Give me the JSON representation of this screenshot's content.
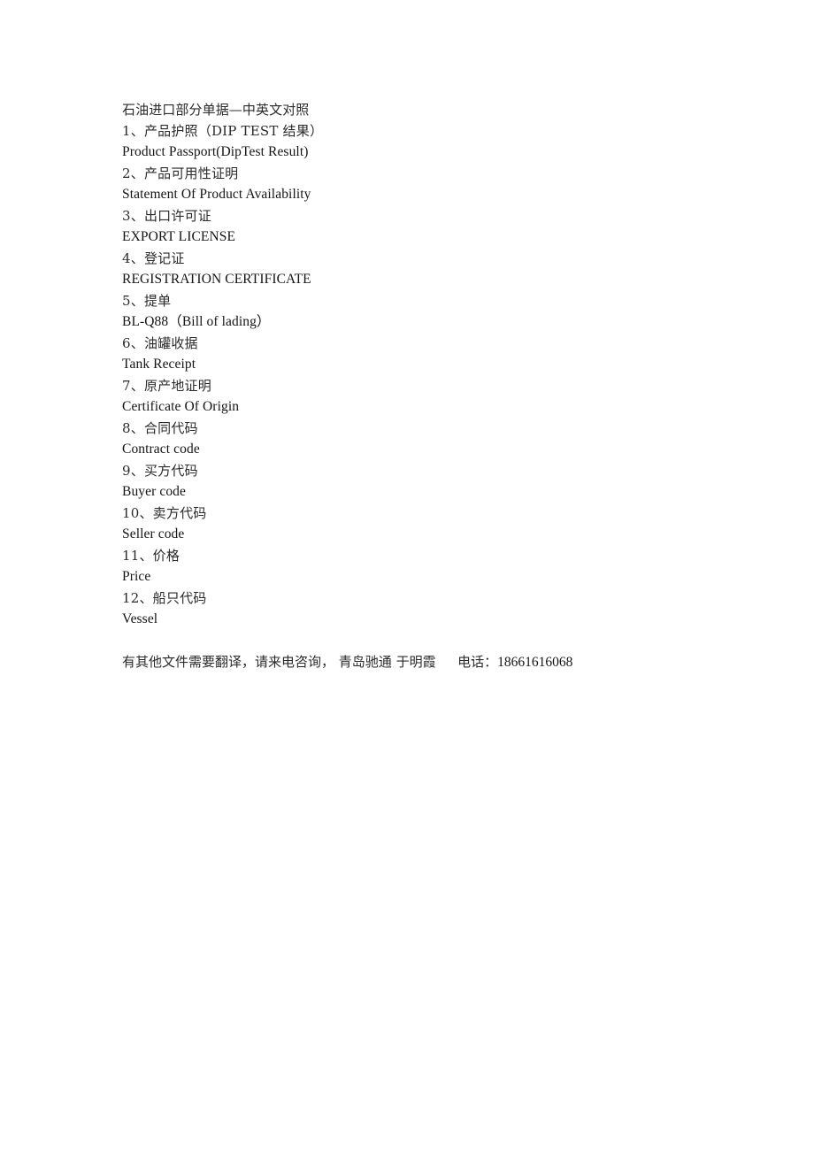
{
  "document": {
    "title": "石油进口部分单据—中英文对照",
    "lines": [
      {
        "lang": "cn",
        "text": "1、产品护照（DIP TEST 结果）"
      },
      {
        "lang": "en",
        "text": "Product Passport(DipTest Result)"
      },
      {
        "lang": "cn",
        "text": "2、产品可用性证明"
      },
      {
        "lang": "en",
        "text": "Statement Of Product Availability"
      },
      {
        "lang": "cn",
        "text": "3、出口许可证"
      },
      {
        "lang": "en",
        "text": "EXPORT LICENSE"
      },
      {
        "lang": "cn",
        "text": "4、登记证"
      },
      {
        "lang": "en",
        "text": "REGISTRATION CERTIFICATE"
      },
      {
        "lang": "cn",
        "text": "5、提单"
      },
      {
        "lang": "en",
        "text": "BL-Q88（Bill of lading）"
      },
      {
        "lang": "cn",
        "text": "6、油罐收据"
      },
      {
        "lang": "en",
        "text": "Tank Receipt"
      },
      {
        "lang": "cn",
        "text": "7、原产地证明"
      },
      {
        "lang": "en",
        "text": "Certificate Of Origin"
      },
      {
        "lang": "cn",
        "text": "8、合同代码"
      },
      {
        "lang": "en",
        "text": "Contract code"
      },
      {
        "lang": "cn",
        "text": "9、买方代码"
      },
      {
        "lang": "en",
        "text": "Buyer code"
      },
      {
        "lang": "cn",
        "text": "10、卖方代码"
      },
      {
        "lang": "en",
        "text": "Seller code"
      },
      {
        "lang": "cn",
        "text": "11、价格"
      },
      {
        "lang": "en",
        "text": "Price"
      },
      {
        "lang": "cn",
        "text": "12、船只代码"
      },
      {
        "lang": "en",
        "text": "Vessel"
      }
    ],
    "footer": {
      "notice": "有其他文件需要翻译，请来电咨询，",
      "company": "青岛驰通",
      "contact_person": "于明霞",
      "phone_label": "电话：",
      "phone_number": "18661616068"
    }
  }
}
